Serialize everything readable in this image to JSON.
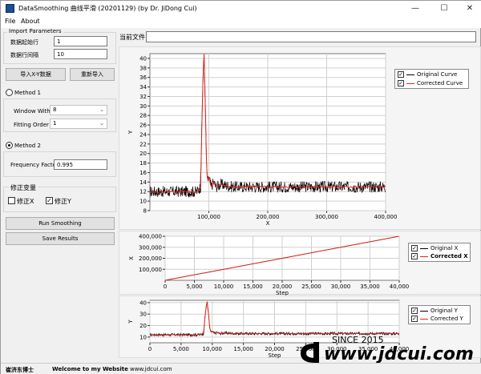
{
  "window": {
    "title": "DataSmoothing 曲线平滑 (20201129) (by Dr. JiDong Cui)",
    "minimize": "—",
    "maximize": "☐",
    "close": "✕"
  },
  "menu": [
    "File",
    "About"
  ],
  "import_params": {
    "group_label": "Import Parameters",
    "start_row_label": "数据起始行",
    "start_row_value": "1",
    "row_interval_label": "数据行间隔",
    "row_interval_value": "10",
    "import_xy_button": "导入X-Y数据",
    "reimport_button": "重新导入"
  },
  "method1": {
    "label": "Method 1",
    "window_width_label": "Window With",
    "window_width_value": "8",
    "fitting_order_label": "Fitting Order",
    "fitting_order_value": "1",
    "selected": false
  },
  "method2": {
    "label": "Method 2",
    "frequency_factor_label": "Frequency Factor",
    "frequency_factor_value": "0.995",
    "selected": true
  },
  "correct_vars": {
    "label": "修正变量",
    "correct_x_label": "修正X",
    "correct_x_checked": false,
    "correct_y_label": "修正Y",
    "correct_y_checked": true
  },
  "actions": {
    "run_smoothing": "Run Smoothing",
    "save_results": "Save Results"
  },
  "current_file": {
    "label": "当前文件",
    "value": ""
  },
  "colors": {
    "original": "#000000",
    "corrected": "#e0261d",
    "plot_bg": "#ffffff",
    "grid": "#d0d0d0"
  },
  "status": {
    "author": "崔济东博士",
    "welcome": "Welcome to my Website",
    "website": "www.jdcui.com",
    "since": "SINCE 2015",
    "brand_url": "www.jdcui.com"
  },
  "chart_data": [
    {
      "type": "line",
      "name": "main-y-vs-x",
      "xlabel": "X",
      "ylabel": "Y",
      "xlim": [
        0,
        400000
      ],
      "ylim": [
        8,
        41
      ],
      "x_ticks": [
        100000,
        200000,
        300000,
        400000
      ],
      "x_tick_labels": [
        "100,000",
        "200,000",
        "300,000",
        "400,000"
      ],
      "y_ticks": [
        8,
        10,
        12,
        14,
        16,
        18,
        20,
        22,
        24,
        26,
        28,
        30,
        32,
        34,
        36,
        38,
        40
      ],
      "y_tick_labels": [
        "8",
        "10",
        "12",
        "14",
        "16",
        "18",
        "20",
        "22",
        "24",
        "26",
        "28",
        "30",
        "32",
        "34",
        "36",
        "38",
        "40"
      ],
      "grid": true,
      "legend_position": "right",
      "legend": [
        {
          "name": "Original Curve",
          "checked": true
        },
        {
          "name": "Corrected Curve",
          "checked": true
        }
      ],
      "series": [
        {
          "name": "Original Curve",
          "x": [
            0,
            80000,
            86000,
            88000,
            90000,
            92000,
            94000,
            96000,
            98000,
            100000,
            104000,
            108000,
            112000,
            120000,
            140000,
            200000,
            300000,
            400000
          ],
          "y": [
            12,
            12,
            13,
            25,
            36,
            40,
            30,
            18,
            14,
            15,
            13,
            14,
            13,
            13.5,
            13,
            13,
            13,
            13
          ]
        },
        {
          "name": "Corrected Curve",
          "x": [
            0,
            80000,
            86000,
            88000,
            90000,
            92000,
            94000,
            96000,
            98000,
            100000,
            104000,
            108000,
            112000,
            120000,
            140000,
            200000,
            300000,
            400000
          ],
          "y": [
            12,
            12,
            13,
            25,
            36,
            41,
            30,
            18,
            14,
            15,
            13,
            14,
            13,
            13.5,
            13,
            13,
            13,
            13
          ]
        }
      ]
    },
    {
      "type": "line",
      "name": "x-vs-step",
      "xlabel": "Step",
      "ylabel": "X",
      "xlim": [
        0,
        40000
      ],
      "ylim": [
        0,
        400000
      ],
      "x_ticks": [
        0,
        5000,
        10000,
        15000,
        20000,
        25000,
        30000,
        35000,
        40000
      ],
      "x_tick_labels": [
        "0",
        "5,000",
        "10,000",
        "15,000",
        "20,000",
        "25,000",
        "30,000",
        "35,000",
        "40,000"
      ],
      "y_ticks": [
        100000,
        200000,
        300000,
        400000
      ],
      "y_tick_labels": [
        "100,000",
        "200,000",
        "300,000",
        "400,000"
      ],
      "grid": true,
      "legend_position": "right",
      "legend": [
        {
          "name": "Original X",
          "checked": true
        },
        {
          "name": "Corrected X",
          "checked": true
        }
      ],
      "series": [
        {
          "name": "Original X",
          "x": [
            0,
            40000
          ],
          "y": [
            0,
            400000
          ]
        },
        {
          "name": "Corrected X",
          "x": [
            0,
            40000
          ],
          "y": [
            0,
            400000
          ]
        }
      ]
    },
    {
      "type": "line",
      "name": "y-vs-step",
      "xlabel": "Step",
      "ylabel": "Y",
      "xlim": [
        0,
        40000
      ],
      "ylim": [
        5,
        42
      ],
      "x_ticks": [
        0,
        5000,
        10000,
        15000,
        20000,
        25000,
        30000,
        35000,
        40000
      ],
      "x_tick_labels": [
        "0",
        "5,000",
        "10,000",
        "15,000",
        "20,000",
        "25,000",
        "30,000",
        "35,000",
        "40,000"
      ],
      "y_ticks": [
        10,
        20,
        30,
        40
      ],
      "y_tick_labels": [
        "10",
        "20",
        "30",
        "40"
      ],
      "grid": true,
      "legend_position": "right",
      "legend": [
        {
          "name": "Original Y",
          "checked": true
        },
        {
          "name": "Corrected Y",
          "checked": true
        }
      ],
      "series": [
        {
          "name": "Original Y",
          "x": [
            0,
            8000,
            8600,
            8800,
            9000,
            9200,
            9400,
            9600,
            9800,
            10000,
            10400,
            10800,
            11200,
            12000,
            14000,
            20000,
            30000,
            40000
          ],
          "y": [
            12,
            12,
            13,
            25,
            36,
            40,
            30,
            18,
            14,
            15,
            13,
            14,
            13,
            13.5,
            13,
            13,
            13,
            13
          ]
        },
        {
          "name": "Corrected Y",
          "x": [
            0,
            8000,
            8600,
            8800,
            9000,
            9200,
            9400,
            9600,
            9800,
            10000,
            10400,
            10800,
            11200,
            12000,
            14000,
            20000,
            30000,
            40000
          ],
          "y": [
            12,
            12,
            13,
            25,
            36,
            41,
            30,
            18,
            14,
            15,
            13,
            14,
            13,
            13.5,
            13,
            13,
            13,
            13
          ]
        }
      ]
    }
  ]
}
